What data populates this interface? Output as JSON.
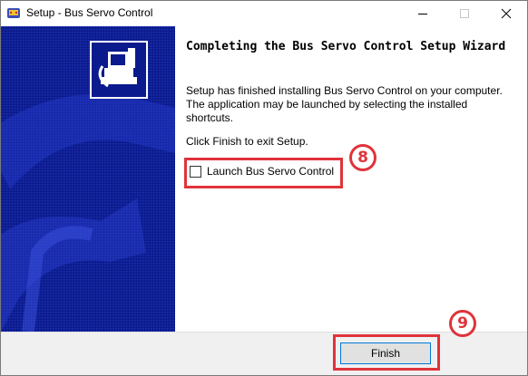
{
  "window": {
    "title": "Setup - Bus Servo Control",
    "controls": [
      "minimize-icon",
      "maximize-icon",
      "close-icon"
    ]
  },
  "content": {
    "heading": "Completing the Bus Servo Control Setup Wizard",
    "paragraph1": "Setup has finished installing Bus Servo Control on your computer. The application may be launched by selecting the installed shortcuts.",
    "paragraph2": "Click Finish to exit Setup.",
    "launch_checkbox": {
      "label": "Launch Bus Servo Control",
      "checked": false
    }
  },
  "footer": {
    "finish_label": "Finish"
  },
  "annotations": {
    "step8": "8",
    "step9": "9",
    "highlight_color": "#e0333b"
  },
  "colors": {
    "side_panel": "#0b1a8c",
    "button_focus_border": "#0078d7"
  }
}
